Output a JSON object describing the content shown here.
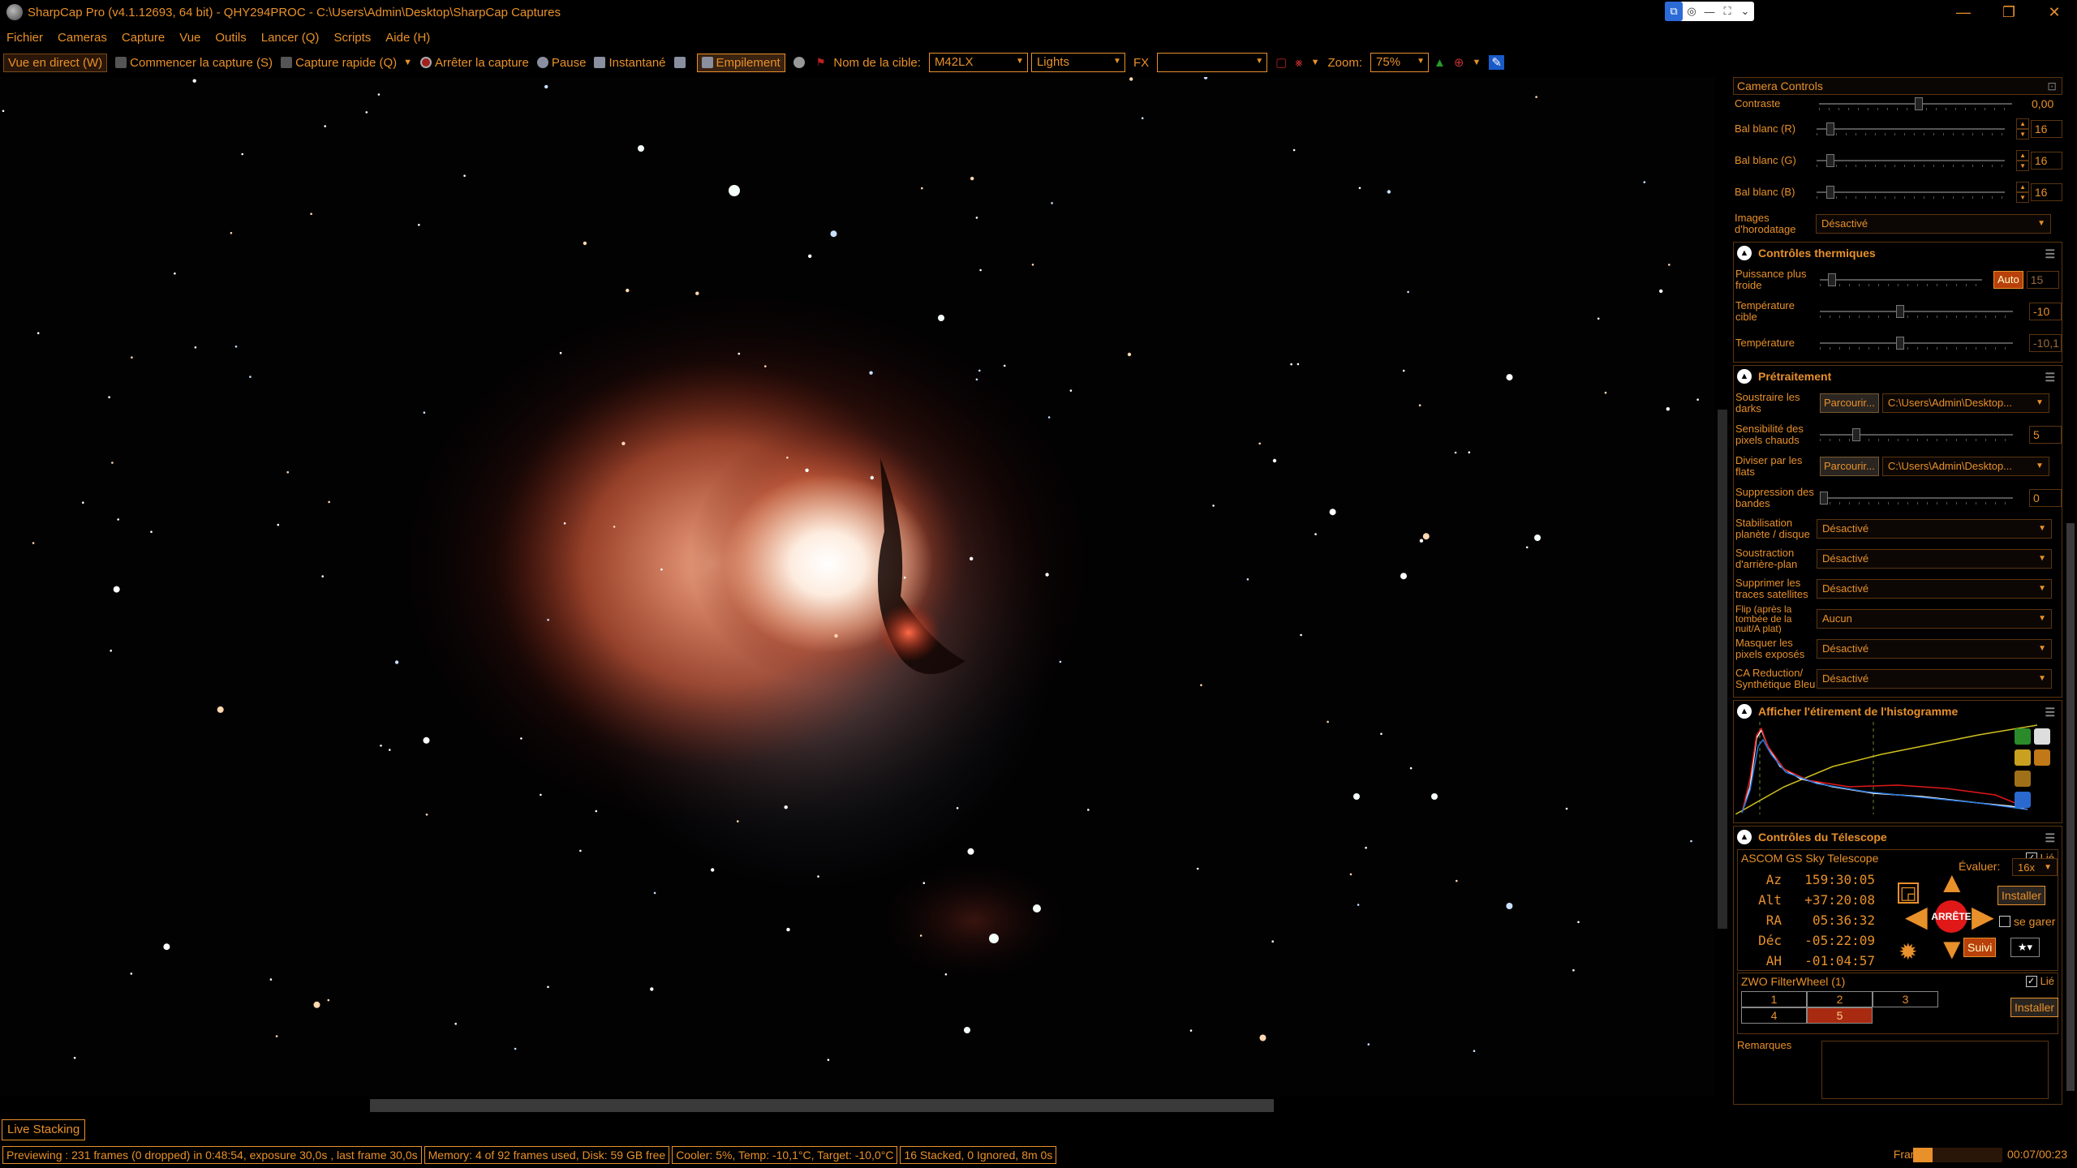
{
  "window": {
    "title": "SharpCap Pro (v4.1.12693, 64 bit) - QHY294PROC - C:\\Users\\Admin\\Desktop\\SharpCap Captures"
  },
  "menu": [
    "Fichier",
    "Cameras",
    "Capture",
    "Vue",
    "Outils",
    "Lancer (Q)",
    "Scripts",
    "Aide (H)"
  ],
  "toolbar": {
    "live_view": "Vue en direct (W)",
    "start_capture": "Commencer la capture (S)",
    "quick_capture": "Capture rapide (Q)",
    "stop_capture": "Arrêter la capture",
    "pause": "Pause",
    "snapshot": "Instantané",
    "stacking": "Empilement",
    "target_label": "Nom de la cible:",
    "target_value": "M42LX",
    "frame_type": "Lights",
    "fx_label": "FX",
    "fx_value": "",
    "zoom_label": "Zoom:",
    "zoom_value": "75%"
  },
  "live_stacking_tab": "Live Stacking",
  "status": {
    "previewing": "Previewing : 231 frames (0 dropped) in 0:48:54, exposure 30,0s , last frame 30,0s",
    "memory": "Memory: 4 of 92 frames used, Disk: 59 GB free",
    "cooler": "Cooler: 5%, Temp: -10,1°C, Target: -10,0°C",
    "stacked": "16 Stacked, 0 Ignored, 8m 0s",
    "frame_label": "Frame :",
    "frame_time": "00:07/00:23",
    "frame_progress": 0.3
  },
  "panel": {
    "header": "Camera Controls",
    "camera": {
      "contraste_label": "Contraste",
      "contraste_value": "0,00",
      "bal_r_label": "Bal blanc (R)",
      "bal_r_value": "16",
      "bal_g_label": "Bal blanc (G)",
      "bal_g_value": "16",
      "bal_b_label": "Bal blanc (B)",
      "bal_b_value": "16",
      "timestamp_label": "Images d'horodatage",
      "timestamp_value": "Désactivé"
    },
    "thermal": {
      "title": "Contrôles thermiques",
      "power_label": "Puissance plus froide",
      "power_auto": "Auto",
      "power_value": "15",
      "target_label": "Température cible",
      "target_value": "-10",
      "temp_label": "Température",
      "temp_value": "-10,1"
    },
    "preprocess": {
      "title": "Prétraitement",
      "darks_label": "Soustraire les darks",
      "browse": "Parcourir...",
      "darks_path": "C:\\Users\\Admin\\Desktop...",
      "hotpix_label": "Sensibilité des pixels chauds",
      "hotpix_value": "5",
      "flats_label": "Diviser par les flats",
      "flats_path": "C:\\Users\\Admin\\Desktop...",
      "banding_label": "Suppression des bandes",
      "banding_value": "0",
      "stab_label": "Stabilisation planète / disque",
      "stab_value": "Désactivé",
      "bg_label": "Soustraction d'arrière-plan",
      "bg_value": "Désactivé",
      "sat_label": "Supprimer les traces satellites",
      "sat_value": "Désactivé",
      "flip_label": "Flip (après la tombée de la nuit/A plat)",
      "flip_value": "Aucun",
      "overexp_label": "Masquer les pixels exposés",
      "overexp_value": "Désactivé",
      "ca_label": "CA Reduction/ Synthétique Bleu",
      "ca_value": "Désactivé"
    },
    "histogram": {
      "title": "Afficher l'étirement de l'histogramme"
    },
    "telescope": {
      "title": "Contrôles du Télescope",
      "name": "ASCOM GS Sky Telescope",
      "linked": "Lié",
      "coords": [
        {
          "k": "Az",
          "v": "159:30:05"
        },
        {
          "k": "Alt",
          "v": "+37:20:08"
        },
        {
          "k": "RA",
          "v": "05:36:32"
        },
        {
          "k": "Déc",
          "v": "-05:22:09"
        },
        {
          "k": "AH",
          "v": "-01:04:57"
        }
      ],
      "rate_label": "Évaluer:",
      "rate_value": "16x",
      "install": "Installer",
      "stop": "ARRÊTE",
      "park": "se garer",
      "track": "Suivi"
    },
    "filterwheel": {
      "name": "ZWO FilterWheel (1)",
      "linked": "Lié",
      "slots": [
        "1",
        "2",
        "3",
        "4",
        "5"
      ],
      "selected": "5",
      "install": "Installer"
    },
    "remarks_label": "Remarques"
  },
  "colors": {
    "accent": "#e8902a",
    "nebula_core": "#fff4e8",
    "nebula_red": "#c0402a"
  }
}
